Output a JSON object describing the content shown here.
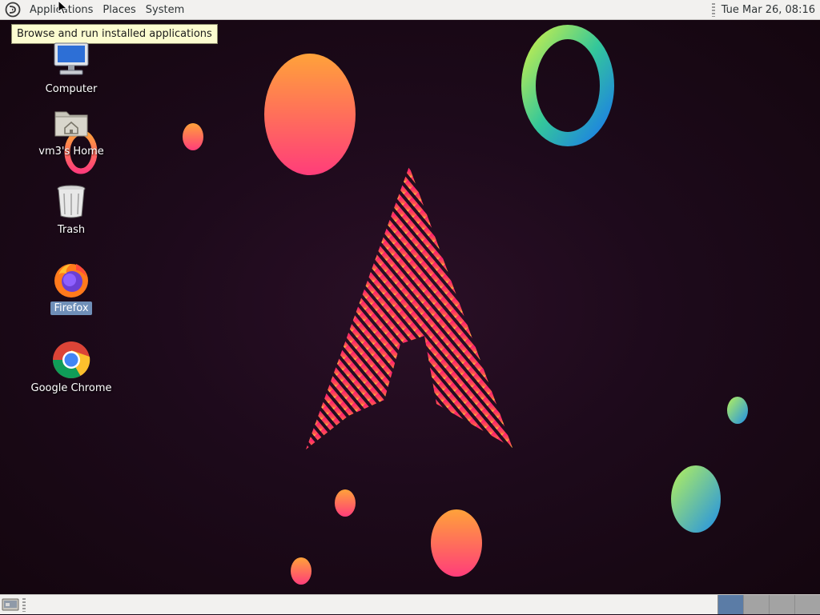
{
  "top_panel": {
    "menus": [
      "Applications",
      "Places",
      "System"
    ],
    "clock": "Tue Mar 26, 08:16"
  },
  "tooltip": "Browse and run installed applications",
  "desktop_icons": [
    {
      "label": "Computer",
      "icon": "computer-icon"
    },
    {
      "label": "vm3's Home",
      "icon": "home-folder-icon"
    },
    {
      "label": "Trash",
      "icon": "trash-icon"
    },
    {
      "label": "Firefox",
      "icon": "firefox-icon",
      "selected": true
    },
    {
      "label": "Google Chrome",
      "icon": "chrome-icon"
    }
  ],
  "bottom_panel": {
    "workspaces": 4,
    "active_workspace": 1
  },
  "colors": {
    "panel_bg": "#f2f1ef",
    "desktop_bg": "#1d0a1b",
    "selection": "#6f8fb8",
    "tooltip_bg": "#fcfcd0",
    "active_workspace": "#5b7ca6"
  }
}
